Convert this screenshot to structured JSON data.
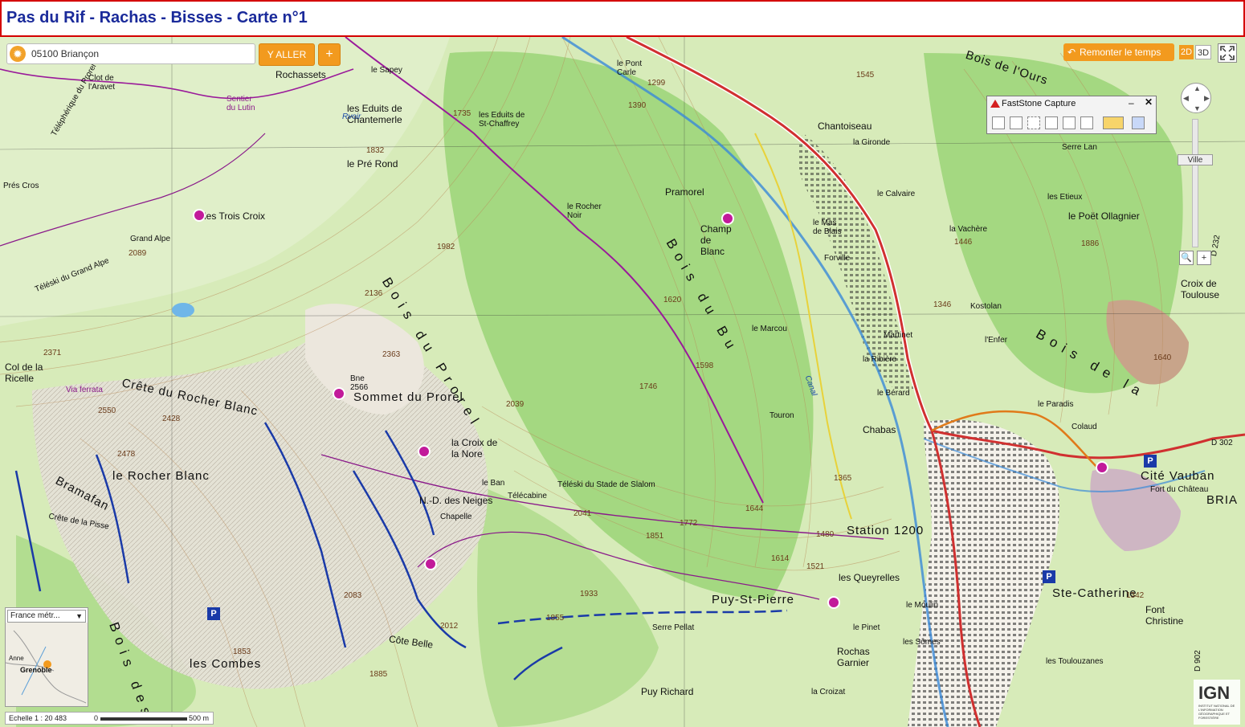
{
  "header": {
    "title": "Pas du Rif - Rachas - Bisses - Carte n°1"
  },
  "search": {
    "value": "05100 Briançon",
    "icon": "locate-icon"
  },
  "toolbar": {
    "go_label": "Y ALLER",
    "plus_label": "+",
    "back_label": "Remonter le temps",
    "mode_2d": "2D",
    "mode_3d": "3D"
  },
  "faststone": {
    "title": "FastStone Capture",
    "min": "–",
    "close": "✕"
  },
  "zoom": {
    "level_label": "Ville"
  },
  "minimap": {
    "select_value": "France métr...",
    "labels": [
      "Anne",
      "Grenoble"
    ]
  },
  "scale": {
    "text": "Echelle 1 : 20 483",
    "start": "0",
    "end": "500 m"
  },
  "ign": {
    "logo": "IGN",
    "sub": "INSTITUT NATIONAL DE L'INFORMATION GÉOGRAPHIQUE ET FORESTIÈRE"
  },
  "colors": {
    "header_border": "#d40000",
    "title": "#1a2a9a",
    "accent": "#f29a1e",
    "forest": "#cfe7ae",
    "road": "#d03030",
    "route_purple": "#8a1a8a",
    "lift_blue": "#1a3aa8"
  },
  "places": [
    {
      "text": "Rochassets",
      "cls": "lbl-m"
    },
    {
      "text": "le Sapey",
      "cls": "lbl-s"
    },
    {
      "text": "les Eduits de Chantemerle",
      "cls": "lbl-m"
    },
    {
      "text": "les Eduits de St-Chaffrey",
      "cls": "lbl-s"
    },
    {
      "text": "le Pré Rond",
      "cls": "lbl-m"
    },
    {
      "text": "le Pont Carle",
      "cls": "lbl-s"
    },
    {
      "text": "Chantoiseau",
      "cls": "lbl-m"
    },
    {
      "text": "la Gironde",
      "cls": "lbl-s"
    },
    {
      "text": "le Calvaire",
      "cls": "lbl-s"
    },
    {
      "text": "Pramorel",
      "cls": "lbl-m"
    },
    {
      "text": "Champ de Blanc",
      "cls": "lbl-m"
    },
    {
      "text": "le Mas de Blais",
      "cls": "lbl-s"
    },
    {
      "text": "Forville",
      "cls": "lbl-s"
    },
    {
      "text": "le Rocher Noir",
      "cls": "lbl-s"
    },
    {
      "text": "les Trois Croix",
      "cls": "lbl-m"
    },
    {
      "text": "Grand Alpe",
      "cls": "lbl-s"
    },
    {
      "text": "Col de la Ricelle",
      "cls": "lbl-m"
    },
    {
      "text": "Sommet du Prorel",
      "cls": "lbl-l"
    },
    {
      "text": "Crête du Rocher Blanc",
      "cls": "lbl-l"
    },
    {
      "text": "le Rocher Blanc",
      "cls": "lbl-l"
    },
    {
      "text": "Bramafan",
      "cls": "lbl-l"
    },
    {
      "text": "Crête de la Pisse",
      "cls": "lbl-s"
    },
    {
      "text": "la Croix de la Nore",
      "cls": "lbl-m"
    },
    {
      "text": "N.-D. des Neiges",
      "cls": "lbl-m"
    },
    {
      "text": "le Ban",
      "cls": "lbl-s"
    },
    {
      "text": "Téléski du Stade de Slalom",
      "cls": "lbl-s"
    },
    {
      "text": "Station 1200",
      "cls": "lbl-l"
    },
    {
      "text": "Puy-St-Pierre",
      "cls": "lbl-l"
    },
    {
      "text": "les Queyrelles",
      "cls": "lbl-m"
    },
    {
      "text": "le Pinet",
      "cls": "lbl-s"
    },
    {
      "text": "Rochas Garnier",
      "cls": "lbl-m"
    },
    {
      "text": "les Combes",
      "cls": "lbl-l"
    },
    {
      "text": "Puy Richard",
      "cls": "lbl-m"
    },
    {
      "text": "Côte Belle",
      "cls": "lbl-m"
    },
    {
      "text": "Serre Pellat",
      "cls": "lbl-s"
    },
    {
      "text": "le Marcou",
      "cls": "lbl-s"
    },
    {
      "text": "la Ribière",
      "cls": "lbl-s"
    },
    {
      "text": "le Bérard",
      "cls": "lbl-s"
    },
    {
      "text": "Chabas",
      "cls": "lbl-m"
    },
    {
      "text": "Cité Vauban",
      "cls": "lbl-l"
    },
    {
      "text": "Ste-Catherine",
      "cls": "lbl-l"
    },
    {
      "text": "Font Christine",
      "cls": "lbl-m"
    },
    {
      "text": "les Toulouzanes",
      "cls": "lbl-s"
    },
    {
      "text": "Serre Lan",
      "cls": "lbl-s"
    },
    {
      "text": "les Etieux",
      "cls": "lbl-s"
    },
    {
      "text": "le Poët Ollagnier",
      "cls": "lbl-m"
    },
    {
      "text": "la Vachère",
      "cls": "lbl-s"
    },
    {
      "text": "Croix de Toulouse",
      "cls": "lbl-m"
    },
    {
      "text": "le Paradis",
      "cls": "lbl-s"
    },
    {
      "text": "Colaud",
      "cls": "lbl-s"
    },
    {
      "text": "Kostolan",
      "cls": "lbl-s"
    },
    {
      "text": "Martinet",
      "cls": "lbl-s"
    },
    {
      "text": "l'Enfer",
      "cls": "lbl-s"
    },
    {
      "text": "Bois de l'Ours",
      "cls": "lbl-l"
    },
    {
      "text": "Bois du Prorel",
      "cls": "lbl-xl"
    },
    {
      "text": "Bois du Bu",
      "cls": "lbl-xl"
    },
    {
      "text": "Bois de la",
      "cls": "lbl-xl"
    },
    {
      "text": "Bois des",
      "cls": "lbl-xl"
    },
    {
      "text": "Prés Cros",
      "cls": "lbl-s"
    },
    {
      "text": "Clot de l'Aravet",
      "cls": "lbl-s"
    },
    {
      "text": "Sentier du Lutin",
      "cls": "lbl-s"
    },
    {
      "text": "Via ferrata",
      "cls": "lbl-s"
    },
    {
      "text": "Téléphérique du Prorel",
      "cls": "lbl-s"
    },
    {
      "text": "Téléski du Grand Alpe",
      "cls": "lbl-s"
    },
    {
      "text": "Télécabine",
      "cls": "lbl-s"
    },
    {
      "text": "le Moulin",
      "cls": "lbl-s"
    },
    {
      "text": "les Sômes",
      "cls": "lbl-s"
    },
    {
      "text": "la Croizat",
      "cls": "lbl-s"
    },
    {
      "text": "Bne 2566",
      "cls": "lbl-s"
    },
    {
      "text": "Fort du Château",
      "cls": "lbl-s"
    },
    {
      "text": "BRIA",
      "cls": "lbl-l"
    },
    {
      "text": "Chapelle",
      "cls": "lbl-s"
    },
    {
      "text": "Touron",
      "cls": "lbl-s"
    },
    {
      "text": "2371",
      "cls": "lbl-s"
    },
    {
      "text": "2136",
      "cls": "lbl-s"
    },
    {
      "text": "2363",
      "cls": "lbl-s"
    },
    {
      "text": "1982",
      "cls": "lbl-s"
    },
    {
      "text": "2039",
      "cls": "lbl-s"
    },
    {
      "text": "1746",
      "cls": "lbl-s"
    },
    {
      "text": "1598",
      "cls": "lbl-s"
    },
    {
      "text": "1620",
      "cls": "lbl-s"
    },
    {
      "text": "1832",
      "cls": "lbl-s"
    },
    {
      "text": "1735",
      "cls": "lbl-s"
    },
    {
      "text": "1390",
      "cls": "lbl-s"
    },
    {
      "text": "1299",
      "cls": "lbl-s"
    },
    {
      "text": "2041",
      "cls": "lbl-s"
    },
    {
      "text": "1933",
      "cls": "lbl-s"
    },
    {
      "text": "1855",
      "cls": "lbl-s"
    },
    {
      "text": "2083",
      "cls": "lbl-s"
    },
    {
      "text": "1853",
      "cls": "lbl-s"
    },
    {
      "text": "1885",
      "cls": "lbl-s"
    },
    {
      "text": "2012",
      "cls": "lbl-s"
    },
    {
      "text": "2478",
      "cls": "lbl-s"
    },
    {
      "text": "2550",
      "cls": "lbl-s"
    },
    {
      "text": "2428",
      "cls": "lbl-s"
    },
    {
      "text": "1640",
      "cls": "lbl-s"
    },
    {
      "text": "1886",
      "cls": "lbl-s"
    },
    {
      "text": "2089",
      "cls": "lbl-s"
    },
    {
      "text": "1446",
      "cls": "lbl-s"
    },
    {
      "text": "1545",
      "cls": "lbl-s"
    },
    {
      "text": "1365",
      "cls": "lbl-s"
    },
    {
      "text": "1480",
      "cls": "lbl-s"
    },
    {
      "text": "1644",
      "cls": "lbl-s"
    },
    {
      "text": "1772",
      "cls": "lbl-s"
    },
    {
      "text": "1851",
      "cls": "lbl-s"
    },
    {
      "text": "1614",
      "cls": "lbl-s"
    },
    {
      "text": "1521",
      "cls": "lbl-s"
    },
    {
      "text": "1346",
      "cls": "lbl-s"
    },
    {
      "text": "1342",
      "cls": "lbl-s"
    },
    {
      "text": "D 902",
      "cls": "lbl-s"
    },
    {
      "text": "D 302",
      "cls": "lbl-s"
    },
    {
      "text": "D 232",
      "cls": "lbl-s"
    },
    {
      "text": "Rvoir",
      "cls": "lbl-s"
    },
    {
      "text": "Canal",
      "cls": "lbl-s"
    }
  ]
}
